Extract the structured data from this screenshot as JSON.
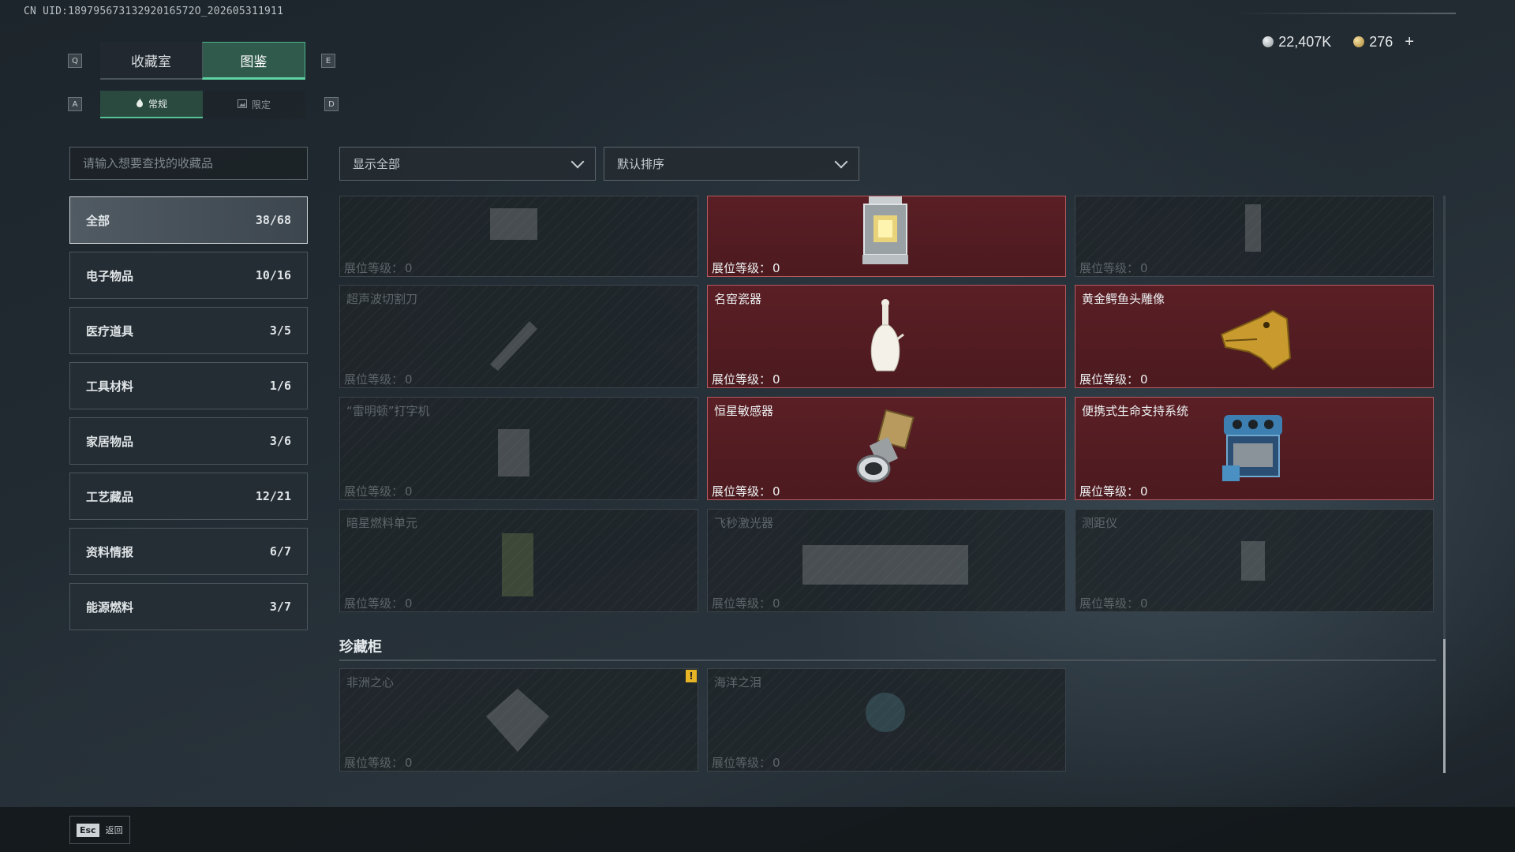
{
  "uid": "CN UID:18979567313292016572O_202605311911",
  "keys": {
    "q": "Q",
    "e": "E",
    "a": "A",
    "d": "D"
  },
  "tabs": [
    {
      "label": "收藏室"
    },
    {
      "label": "图鉴"
    }
  ],
  "subtabs": [
    {
      "label": "常规"
    },
    {
      "label": "限定"
    }
  ],
  "currency": {
    "silver": "22,407K",
    "gold": "276",
    "add": "+"
  },
  "search": {
    "placeholder": "请输入想要查找的收藏品"
  },
  "categories": [
    {
      "name": "全部",
      "count": "38/68"
    },
    {
      "name": "电子物品",
      "count": "10/16"
    },
    {
      "name": "医疗道具",
      "count": "3/5"
    },
    {
      "name": "工具材料",
      "count": "1/6"
    },
    {
      "name": "家居物品",
      "count": "3/6"
    },
    {
      "name": "工艺藏品",
      "count": "12/21"
    },
    {
      "name": "资料情报",
      "count": "6/7"
    },
    {
      "name": "能源燃料",
      "count": "3/7"
    }
  ],
  "filters": {
    "show": "显示全部",
    "sort": "默认排序"
  },
  "level_label": "展位等级：",
  "items": [
    {
      "name": "",
      "level": "0",
      "owned": false,
      "icon": "device-icon"
    },
    {
      "name": "",
      "level": "0",
      "owned": true,
      "icon": "lantern-icon"
    },
    {
      "name": "",
      "level": "0",
      "owned": false,
      "icon": "bottle-icon"
    },
    {
      "name": "超声波切割刀",
      "level": "0",
      "owned": false,
      "icon": "knife-icon"
    },
    {
      "name": "名窑瓷器",
      "level": "0",
      "owned": true,
      "icon": "porcelain-vase-icon"
    },
    {
      "name": "黄金鳄鱼头雕像",
      "level": "0",
      "owned": true,
      "icon": "gold-crocodile-icon"
    },
    {
      "name": "“雷明顿”打字机",
      "level": "0",
      "owned": false,
      "icon": "typewriter-icon"
    },
    {
      "name": "恒星敏感器",
      "level": "0",
      "owned": true,
      "icon": "star-sensor-icon"
    },
    {
      "name": "便携式生命支持系统",
      "level": "0",
      "owned": true,
      "icon": "life-support-icon"
    },
    {
      "name": "暗星燃料单元",
      "level": "0",
      "owned": false,
      "icon": "fuel-cell-icon"
    },
    {
      "name": "飞秒激光器",
      "level": "0",
      "owned": false,
      "icon": "laser-icon"
    },
    {
      "name": "测距仪",
      "level": "0",
      "owned": false,
      "icon": "rangefinder-icon"
    }
  ],
  "showcase": {
    "title": "珍藏柜",
    "items": [
      {
        "name": "非洲之心",
        "level": "0",
        "owned": false,
        "icon": "diamond-icon",
        "warning": "!"
      },
      {
        "name": "海洋之泪",
        "level": "0",
        "owned": false,
        "icon": "gem-icon"
      }
    ]
  },
  "footer": {
    "key": "Esc",
    "label": "返回"
  },
  "colors": {
    "accent": "#5fd3a2",
    "owned_card": "#521d23",
    "gold_badge": "#e7b425"
  }
}
